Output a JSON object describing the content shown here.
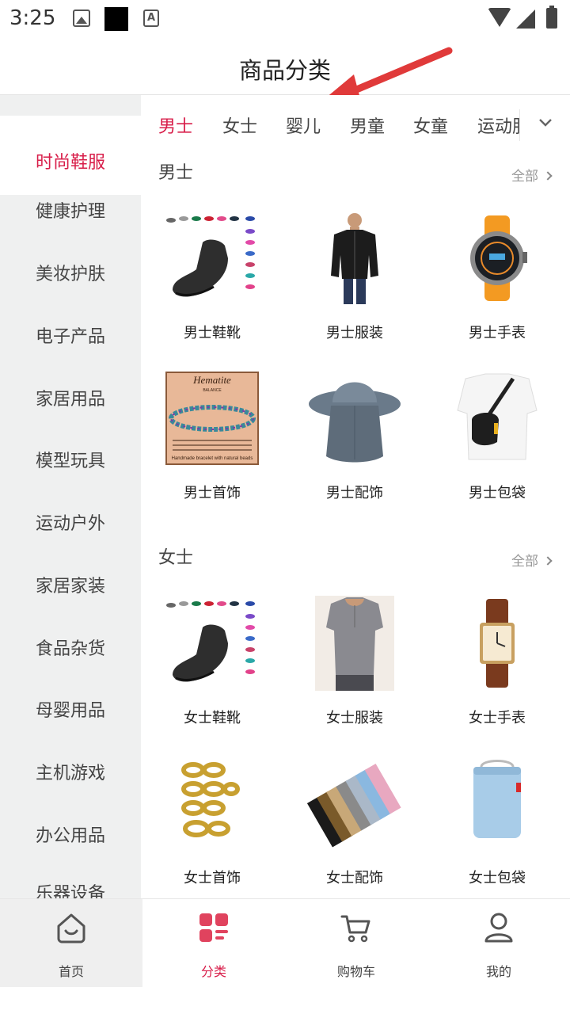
{
  "status_bar": {
    "time": "3:25",
    "icons": [
      "image-icon",
      "black-square-icon",
      "a-icon",
      "wifi-icon",
      "signal-icon",
      "battery-icon"
    ]
  },
  "header": {
    "title": "商品分类"
  },
  "sidebar": {
    "items": [
      {
        "label": "时尚鞋服",
        "active": true
      },
      {
        "label": "健康护理"
      },
      {
        "label": "美妆护肤"
      },
      {
        "label": "电子产品"
      },
      {
        "label": "家居用品"
      },
      {
        "label": "模型玩具"
      },
      {
        "label": "运动户外"
      },
      {
        "label": "家居家装"
      },
      {
        "label": "食品杂货"
      },
      {
        "label": "母婴用品"
      },
      {
        "label": "主机游戏"
      },
      {
        "label": "办公用品"
      },
      {
        "label": "乐器设备"
      }
    ]
  },
  "tabs": {
    "items": [
      {
        "label": "男士",
        "active": true
      },
      {
        "label": "女士"
      },
      {
        "label": "婴儿"
      },
      {
        "label": "男童"
      },
      {
        "label": "女童"
      },
      {
        "label": "运动服"
      }
    ]
  },
  "sections": [
    {
      "title": "男士",
      "all_label": "全部",
      "products": [
        {
          "label": "男士鞋靴",
          "image": "shoes"
        },
        {
          "label": "男士服装",
          "image": "jacket"
        },
        {
          "label": "男士手表",
          "image": "watch-sport"
        },
        {
          "label": "男士首饰",
          "image": "bracelet",
          "image_text": [
            "Hematite",
            "BALANCE",
            "Handmade bracelet with natural beads"
          ]
        },
        {
          "label": "男士配饰",
          "image": "hat"
        },
        {
          "label": "男士包袋",
          "image": "sling-bag"
        }
      ]
    },
    {
      "title": "女士",
      "all_label": "全部",
      "products": [
        {
          "label": "女士鞋靴",
          "image": "shoes"
        },
        {
          "label": "女士服装",
          "image": "top"
        },
        {
          "label": "女士手表",
          "image": "watch-classic"
        },
        {
          "label": "女士首饰",
          "image": "rings"
        },
        {
          "label": "女士配饰",
          "image": "headbands"
        },
        {
          "label": "女士包袋",
          "image": "cooler-bag"
        }
      ]
    }
  ],
  "bottom_nav": {
    "items": [
      {
        "label": "首页",
        "icon": "home-icon"
      },
      {
        "label": "分类",
        "icon": "category-icon",
        "active": true
      },
      {
        "label": "购物车",
        "icon": "cart-icon"
      },
      {
        "label": "我的",
        "icon": "profile-icon"
      }
    ]
  },
  "colors": {
    "accent": "#d81e4a",
    "sidebar_bg": "#eff0f0",
    "annotation_arrow": "#e03a3a"
  }
}
